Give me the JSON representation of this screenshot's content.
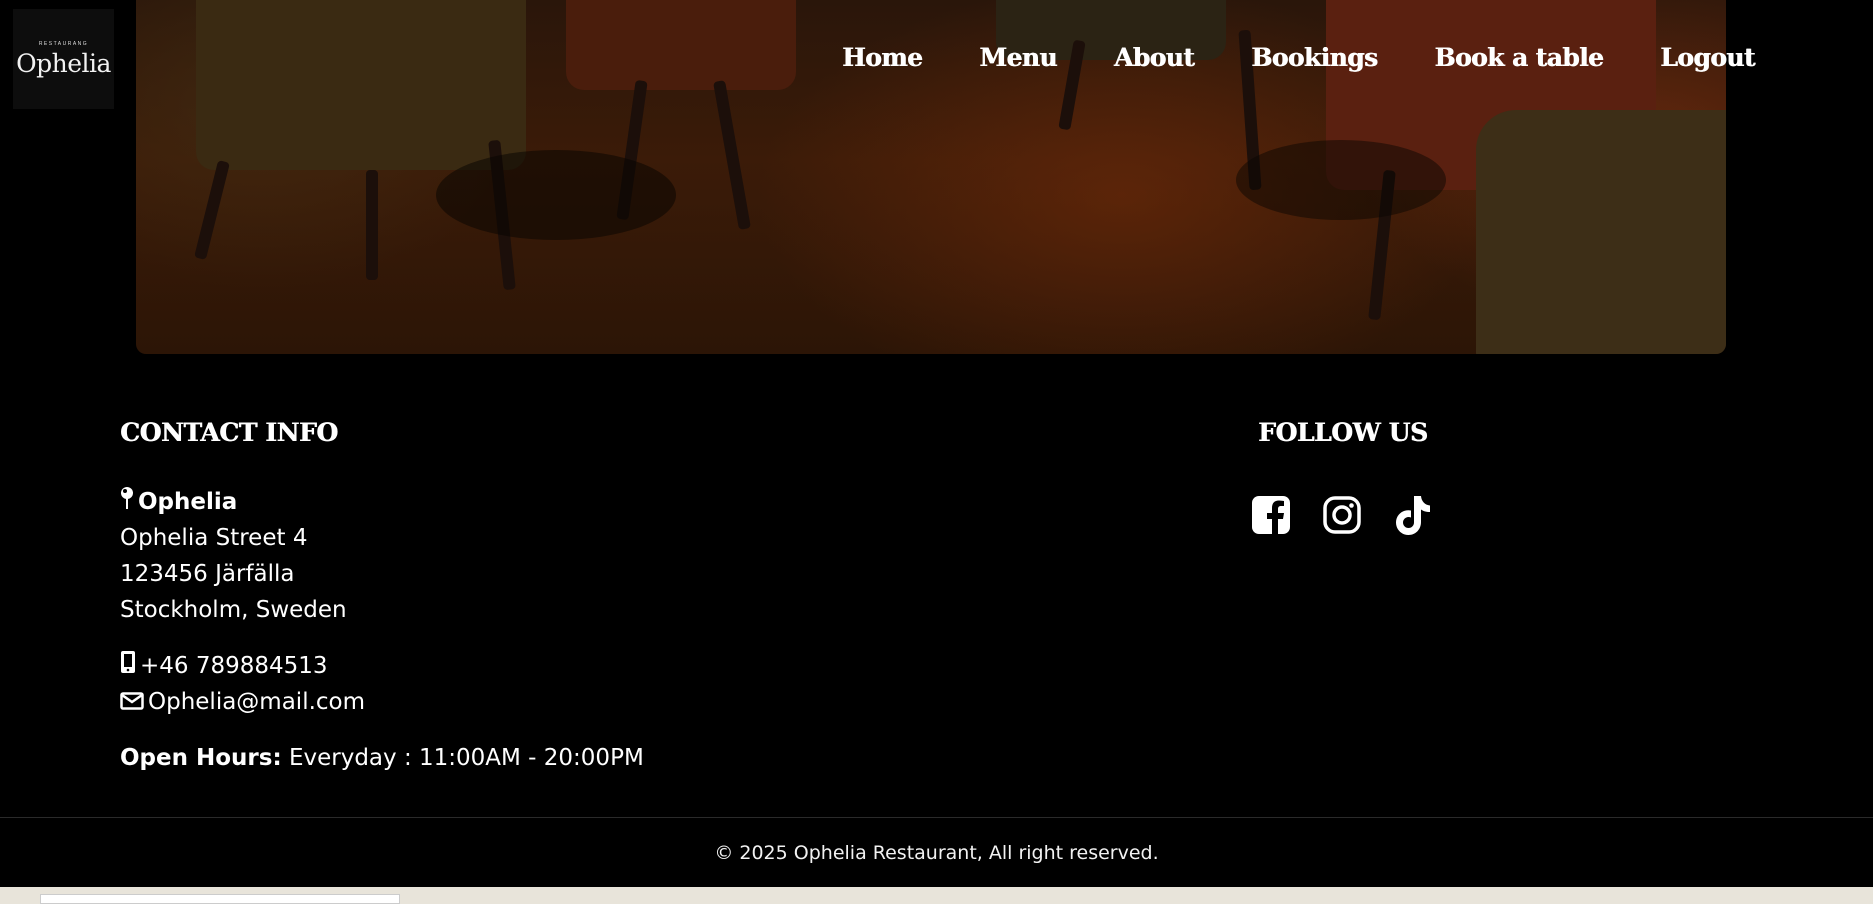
{
  "logo": {
    "subtitle": "RESTAURANG",
    "name": "Ophelia"
  },
  "nav": {
    "items": [
      {
        "label": "Home"
      },
      {
        "label": "Menu"
      },
      {
        "label": "About"
      },
      {
        "label": "Bookings"
      },
      {
        "label": "Book a table"
      },
      {
        "label": "Logout"
      }
    ]
  },
  "contact": {
    "heading": "CONTACT INFO",
    "name": "Ophelia",
    "address_line1": "Ophelia Street 4",
    "address_line2": "123456 Järfälla",
    "address_line3": "Stockholm, Sweden",
    "phone": "+46 789884513",
    "email": "Ophelia@mail.com",
    "hours_label": "Open Hours:",
    "hours_value": "Everyday : 11:00AM - 20:00PM"
  },
  "follow": {
    "heading": "FOLLOW US",
    "icons": [
      "facebook-icon",
      "instagram-icon",
      "tiktok-icon"
    ]
  },
  "footer": {
    "copyright": "© 2025 Ophelia Restaurant, All right reserved."
  },
  "colors": {
    "background": "#000000",
    "text": "#ffffff"
  }
}
